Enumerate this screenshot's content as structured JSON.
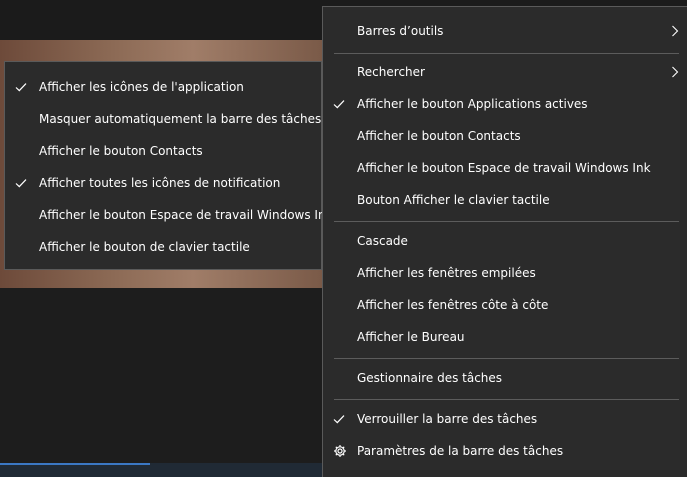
{
  "main_menu": {
    "items": [
      {
        "label": "Barres d’outils",
        "has_submenu": true,
        "checked": false
      },
      {
        "label": "Rechercher",
        "has_submenu": true,
        "checked": false
      },
      {
        "label": "Afficher le bouton Applications actives",
        "has_submenu": false,
        "checked": true
      },
      {
        "label": "Afficher le bouton Contacts",
        "has_submenu": false,
        "checked": false
      },
      {
        "label": "Afficher le bouton Espace de travail Windows Ink",
        "has_submenu": false,
        "checked": false
      },
      {
        "label": "Bouton Afficher le clavier tactile",
        "has_submenu": false,
        "checked": false
      },
      {
        "label": "Cascade",
        "has_submenu": false,
        "checked": false
      },
      {
        "label": "Afficher les fenêtres empilées",
        "has_submenu": false,
        "checked": false
      },
      {
        "label": "Afficher les fenêtres côte à côte",
        "has_submenu": false,
        "checked": false
      },
      {
        "label": "Afficher le Bureau",
        "has_submenu": false,
        "checked": false
      },
      {
        "label": "Gestionnaire des tâches",
        "has_submenu": false,
        "checked": false
      },
      {
        "label": "Verrouiller la barre des tâches",
        "has_submenu": false,
        "checked": true
      },
      {
        "label": "Paramètres de la barre des tâches",
        "has_submenu": false,
        "checked": false,
        "icon": "gear-icon"
      }
    ]
  },
  "sub_menu": {
    "items": [
      {
        "label": "Afficher les icônes de l'application",
        "checked": true
      },
      {
        "label": "Masquer automatiquement la barre des tâches",
        "checked": false
      },
      {
        "label": "Afficher le bouton Contacts",
        "checked": false
      },
      {
        "label": "Afficher toutes les icônes de notification",
        "checked": true
      },
      {
        "label": "Afficher le bouton Espace de travail Windows Ink",
        "checked": false
      },
      {
        "label": "Afficher le bouton de clavier tactile",
        "checked": false
      }
    ]
  },
  "icons": {
    "check": "check-icon",
    "chevron": "chevron-right-icon",
    "gear": "gear-icon"
  },
  "colors": {
    "menu_bg": "#2b2b2b",
    "menu_border": "#5a5a5a",
    "text": "#ffffff",
    "separator": "#5c5c5c"
  }
}
